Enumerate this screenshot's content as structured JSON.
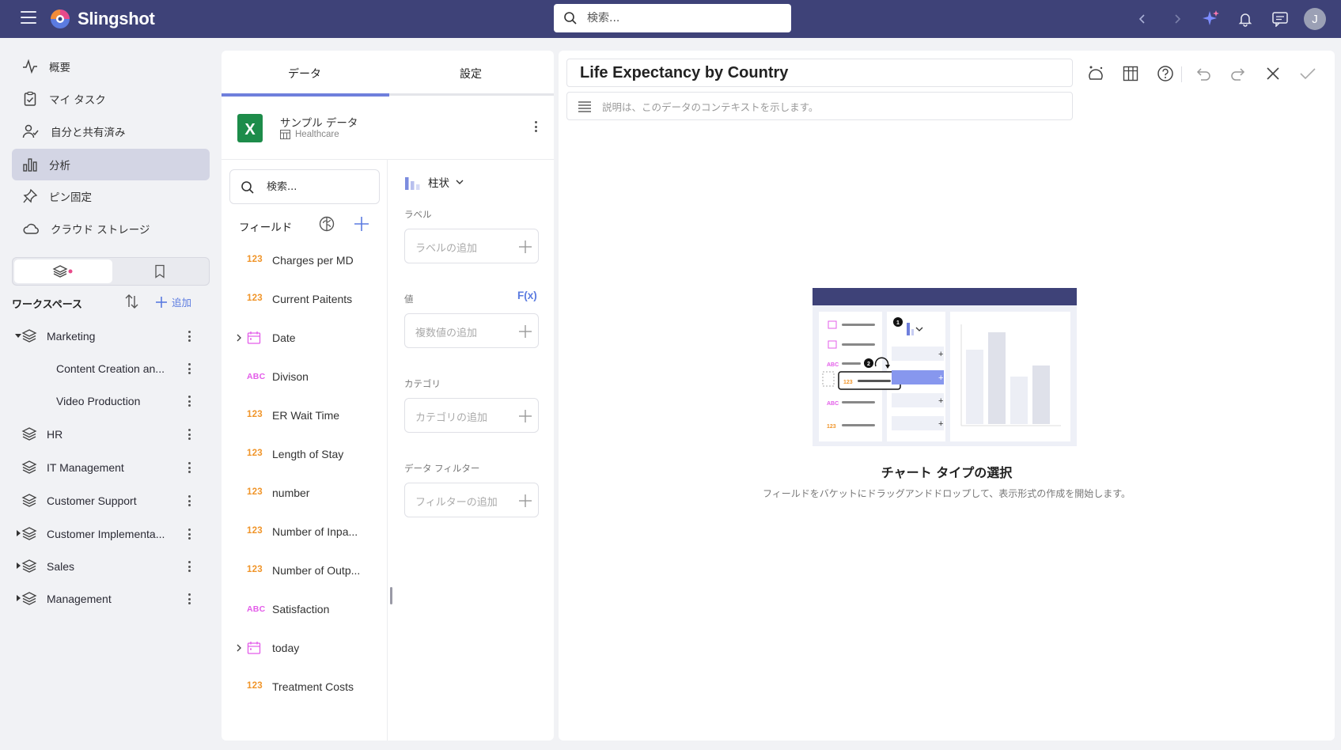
{
  "app": {
    "name": "Slingshot",
    "user_initial": "J"
  },
  "topbar": {
    "search_placeholder": "検索..."
  },
  "nav": {
    "items": [
      {
        "label": "概要",
        "icon": "activity-icon"
      },
      {
        "label": "マイ タスク",
        "icon": "clipboard-check-icon"
      },
      {
        "label": "自分と共有済み",
        "icon": "user-share-icon"
      },
      {
        "label": "分析",
        "icon": "bar-chart-icon",
        "active": true
      },
      {
        "label": "ピン固定",
        "icon": "pin-icon"
      },
      {
        "label": "クラウド ストレージ",
        "icon": "cloud-icon"
      }
    ]
  },
  "workspaces": {
    "title": "ワークスペース",
    "add_label": "追加",
    "items": [
      {
        "label": "Marketing",
        "expanded": true
      },
      {
        "label": "Content Creation an...",
        "child": true
      },
      {
        "label": "Video Production",
        "child": true
      },
      {
        "label": "HR"
      },
      {
        "label": "IT Management"
      },
      {
        "label": "Customer Support"
      },
      {
        "label": "Customer Implementa..."
      },
      {
        "label": "Sales"
      },
      {
        "label": "Management"
      }
    ]
  },
  "data_panel": {
    "tabs": [
      "データ",
      "設定"
    ],
    "datasource": {
      "name": "サンプル データ",
      "table": "Healthcare"
    },
    "search_placeholder": "検索...",
    "fields_title": "フィールド",
    "fields": [
      {
        "type": "123",
        "name": "Charges per MD"
      },
      {
        "type": "123",
        "name": "Current Paitents"
      },
      {
        "type": "date",
        "name": "Date"
      },
      {
        "type": "ABC",
        "name": "Divison"
      },
      {
        "type": "123",
        "name": "ER Wait Time"
      },
      {
        "type": "123",
        "name": "Length of Stay"
      },
      {
        "type": "123",
        "name": "number"
      },
      {
        "type": "123",
        "name": "Number of Inpa..."
      },
      {
        "type": "123",
        "name": "Number of Outp..."
      },
      {
        "type": "ABC",
        "name": "Satisfaction"
      },
      {
        "type": "date",
        "name": "today"
      },
      {
        "type": "123",
        "name": "Treatment Costs"
      }
    ],
    "chart_type": "柱状",
    "sections": {
      "label": {
        "title": "ラベル",
        "placeholder": "ラベルの追加"
      },
      "value": {
        "title": "値",
        "fx": "F(x)",
        "placeholder": "複数値の追加"
      },
      "category": {
        "title": "カテゴリ",
        "placeholder": "カテゴリの追加"
      },
      "filter": {
        "title": "データ フィルター",
        "placeholder": "フィルターの追加"
      }
    }
  },
  "canvas": {
    "title": "Life Expectancy by Country",
    "description_placeholder": "説明は、このデータのコンテキストを示します。",
    "empty_title": "チャート タイプの選択",
    "empty_subtitle": "フィールドをバケットにドラッグアンドドロップして、表示形式の作成を開始します。",
    "illustration": {
      "step1": "1",
      "step2": "2",
      "type_num": "123",
      "type_text": "ABC"
    }
  },
  "colors": {
    "topbar": "#3e4278",
    "accent": "#6f7fdc",
    "number_type": "#f0952a",
    "text_type": "#e35ce9",
    "date_type": "#e35ce9"
  }
}
